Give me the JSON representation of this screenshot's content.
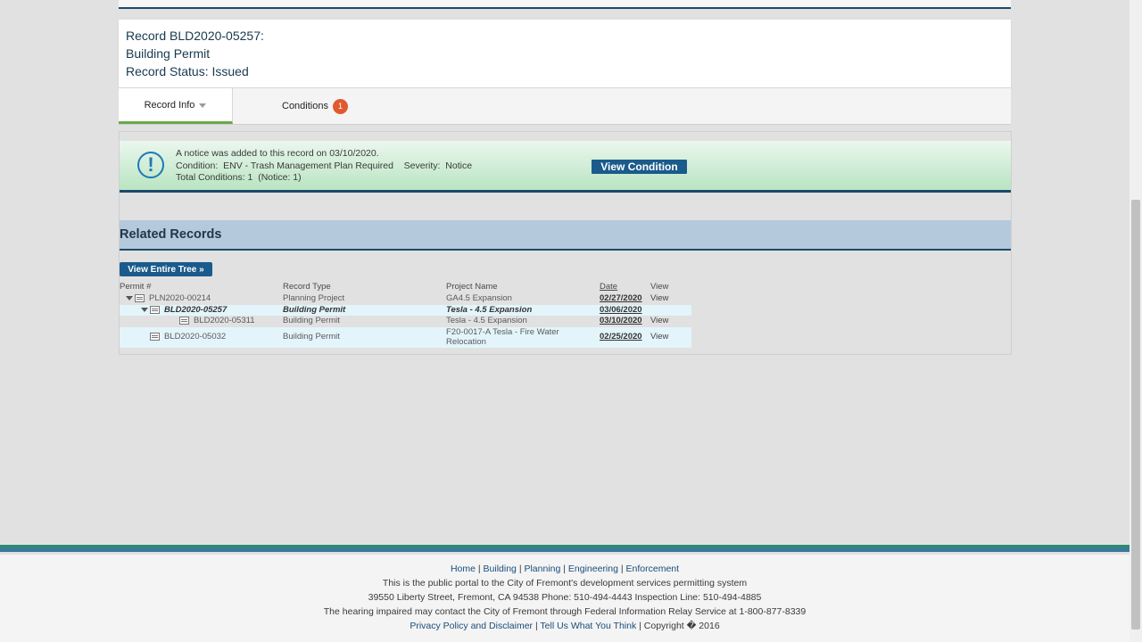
{
  "header": {
    "record_line": "Record BLD2020-05257:",
    "type_line": "Building Permit",
    "status_line": "Record Status: Issued"
  },
  "tabs": [
    {
      "label": "Record Info"
    },
    {
      "label": "Conditions",
      "badge": "1"
    }
  ],
  "notice": {
    "line1": "A notice was added to this record on 03/10/2020.",
    "line2": "Condition:  ENV - Trash Management Plan Required    Severity:  Notice",
    "line3": "Total Conditions: 1  (Notice: 1)",
    "button": "View Condition"
  },
  "related": {
    "title": "Related Records",
    "tree_button": "View Entire Tree »",
    "columns": {
      "permit": "Permit #",
      "type": "Record Type",
      "project": "Project Name",
      "date": "Date",
      "view": "View"
    },
    "rows": [
      {
        "permit": "PLN2020-00214",
        "type": "Planning Project",
        "project": "GA4.5 Expansion",
        "date": "02/27/2020",
        "view": "View"
      },
      {
        "permit": "BLD2020-05257",
        "type": "Building Permit",
        "project": "Tesla - 4.5 Expansion",
        "date": "03/06/2020",
        "view": ""
      },
      {
        "permit": "BLD2020-05311",
        "type": "Building Permit",
        "project": "Tesla - 4.5 Expansion",
        "date": "03/10/2020",
        "view": "View"
      },
      {
        "permit": "BLD2020-05032",
        "type": "Building Permit",
        "project_line1": "F20-0017-A Tesla - Fire Water",
        "project_line2": "Relocation",
        "date": "02/25/2020",
        "view": "View"
      }
    ]
  },
  "footer": {
    "links": [
      "Home",
      "Building",
      "Planning",
      "Engineering",
      "Enforcement"
    ],
    "line2": "This is the public portal to the City of Fremont's development services permitting system",
    "line3": "39550 Liberty Street, Fremont, CA 94538 Phone: 510-494-4443 Inspection Line: 510-494-4885",
    "line4": "The hearing impaired may contact the City of Fremont through Federal Information Relay Service at 1-800-877-8339",
    "privacy": "Privacy Policy and Disclaimer",
    "tell_us": "Tell Us What You Think",
    "copyright": "Copyright � 2016"
  },
  "colors": {
    "accent": "#1a5b8c",
    "badge": "#e05a30",
    "dark_rule": "#1b4a6b"
  }
}
